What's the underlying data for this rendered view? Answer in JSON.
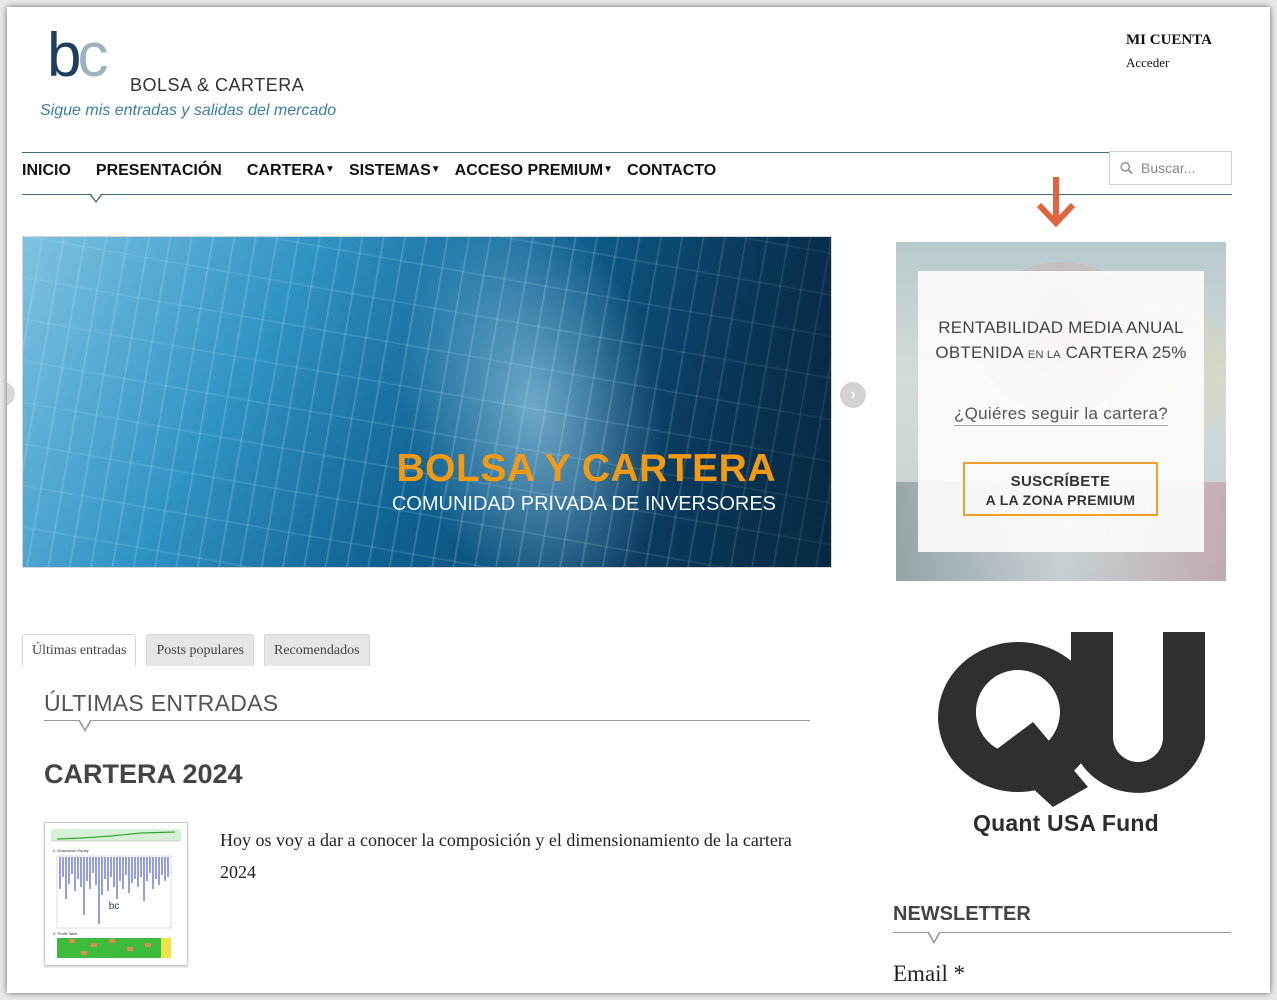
{
  "header": {
    "logo_text": "BOLSA & CARTERA",
    "tagline": "Sigue mis entradas y salidas del mercado",
    "account_title": "MI CUENTA",
    "account_link": "Acceder"
  },
  "nav": {
    "items": [
      {
        "label": "INICIO",
        "dropdown": false
      },
      {
        "label": "PRESENTACIÓN",
        "dropdown": false
      },
      {
        "label": "CARTERA",
        "dropdown": true
      },
      {
        "label": "SISTEMAS",
        "dropdown": true
      },
      {
        "label": "ACCESO PREMIUM",
        "dropdown": true
      },
      {
        "label": "CONTACTO",
        "dropdown": false
      }
    ],
    "search_placeholder": "Buscar..."
  },
  "slider": {
    "title": "BOLSA Y CARTERA",
    "subtitle": "COMUNIDAD PRIVADA DE INVERSORES"
  },
  "ad": {
    "headline_line1": "RENTABILIDAD MEDIA ANUAL",
    "headline_line2_a": "OBTENIDA",
    "headline_line2_small": "EN LA",
    "headline_line2_b": "CARTERA 25%",
    "question": "¿Quiéres seguir la cartera?",
    "button_line1": "SUSCRÍBETE",
    "button_line2": "A LA ZONA PREMIUM"
  },
  "tabs": [
    {
      "label": "Últimas entradas",
      "active": true
    },
    {
      "label": "Posts populares",
      "active": false
    },
    {
      "label": "Recomendados",
      "active": false
    }
  ],
  "main": {
    "section_title": "ÚLTIMAS ENTRADAS",
    "post_title": "CARTERA 2024",
    "post_excerpt": "Hoy os voy a dar a conocer la composición y el dimensionamiento de la cartera 2024"
  },
  "sidebar": {
    "fund_name": "Quant USA Fund",
    "newsletter_title": "NEWSLETTER",
    "email_label": "Email *"
  },
  "colors": {
    "accent_blue": "#3a7fa8",
    "nav_line": "#3d6f80",
    "slider_title": "#f39a12",
    "arrow": "#e0643f",
    "button_border": "#f2a02a"
  },
  "icons": {
    "search": "search-icon",
    "arrow_down": "arrow-down-icon",
    "slider_next": "chevron-right-icon"
  }
}
